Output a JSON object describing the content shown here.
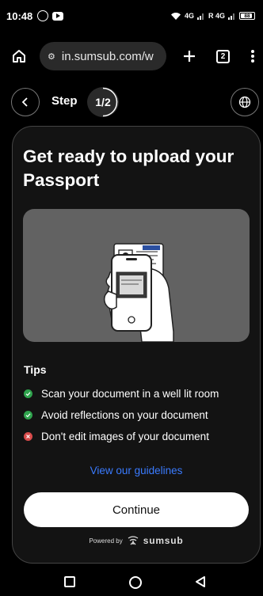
{
  "status_bar": {
    "time": "10:48",
    "signal_primary": "4G",
    "signal_secondary": "R 4G",
    "battery_level": "88",
    "battery_fraction": 0.88
  },
  "browser": {
    "url": "in.sumsub.com/w",
    "tab_count": "2",
    "icons": [
      "home-icon",
      "site-settings-icon",
      "new-tab-icon",
      "tab-switcher-icon",
      "more-menu-icon"
    ]
  },
  "step_header": {
    "label": "Step",
    "progress": "1/2",
    "progress_fraction": 0.5
  },
  "card": {
    "title": "Get ready to upload your Passport",
    "tips_heading": "Tips",
    "tips": [
      {
        "text": "Scan your document in a well lit room",
        "status": "ok"
      },
      {
        "text": "Avoid reflections on your document",
        "status": "ok"
      },
      {
        "text": "Don't edit images of your document",
        "status": "bad"
      }
    ],
    "guidelines_link": "View our guidelines",
    "continue_label": "Continue",
    "powered_by": "Powered by",
    "brand": "sumsub"
  },
  "colors": {
    "background": "#000000",
    "card": "#131313",
    "link": "#3a7bff",
    "tip_ok": "#2fa34d",
    "tip_bad": "#d84b4b",
    "illustration": "#626262"
  }
}
